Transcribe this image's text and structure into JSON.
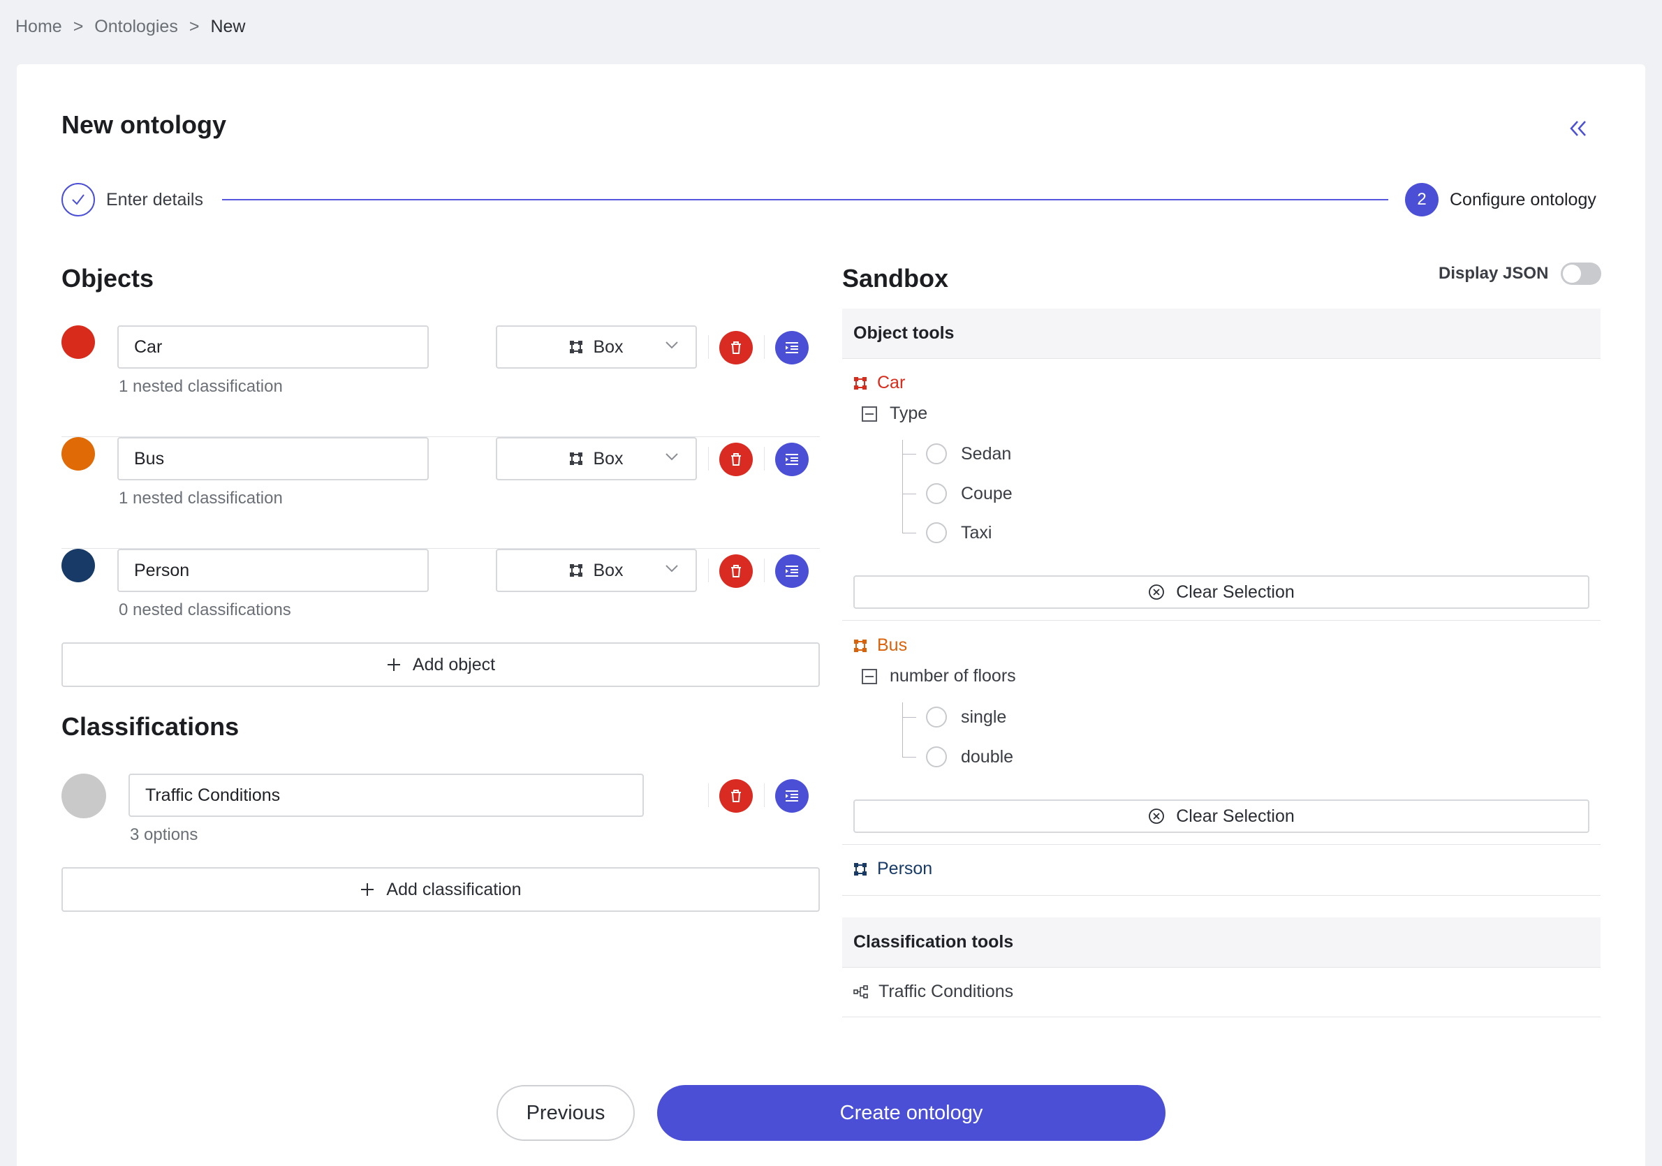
{
  "breadcrumb": {
    "items": [
      "Home",
      "Ontologies",
      "New"
    ],
    "separator": ">"
  },
  "page": {
    "title": "New ontology"
  },
  "stepper": {
    "step1": {
      "label": "Enter details",
      "status": "done"
    },
    "step2": {
      "number": "2",
      "label": "Configure ontology",
      "status": "active"
    }
  },
  "objects": {
    "heading": "Objects",
    "items": [
      {
        "name": "Car",
        "color": "#d92b1b",
        "shape": "Box",
        "nested": "1 nested classification"
      },
      {
        "name": "Bus",
        "color": "#e06a06",
        "shape": "Box",
        "nested": "1 nested classification"
      },
      {
        "name": "Person",
        "color": "#183a66",
        "shape": "Box",
        "nested": "0 nested classifications"
      }
    ],
    "add_label": "Add object"
  },
  "classifications": {
    "heading": "Classifications",
    "items": [
      {
        "name": "Traffic Conditions",
        "color": "#c9c9c9",
        "options": "3 options"
      }
    ],
    "add_label": "Add classification"
  },
  "sandbox": {
    "heading": "Sandbox",
    "display_json_label": "Display JSON",
    "display_json_on": false,
    "object_tools_label": "Object tools",
    "classification_tools_label": "Classification tools",
    "clear_label": "Clear Selection",
    "tools": [
      {
        "name": "Car",
        "color": "#d92b1b",
        "attribute": "Type",
        "options": [
          "Sedan",
          "Coupe",
          "Taxi"
        ]
      },
      {
        "name": "Bus",
        "color": "#d9620a",
        "attribute": "number of floors",
        "options": [
          "single",
          "double"
        ]
      },
      {
        "name": "Person",
        "color": "#183a66"
      }
    ],
    "classification_tools": [
      {
        "name": "Traffic Conditions"
      }
    ]
  },
  "footer": {
    "previous_label": "Previous",
    "create_label": "Create ontology"
  },
  "colors": {
    "accent": "#4b4fd6",
    "danger": "#d92b22"
  }
}
